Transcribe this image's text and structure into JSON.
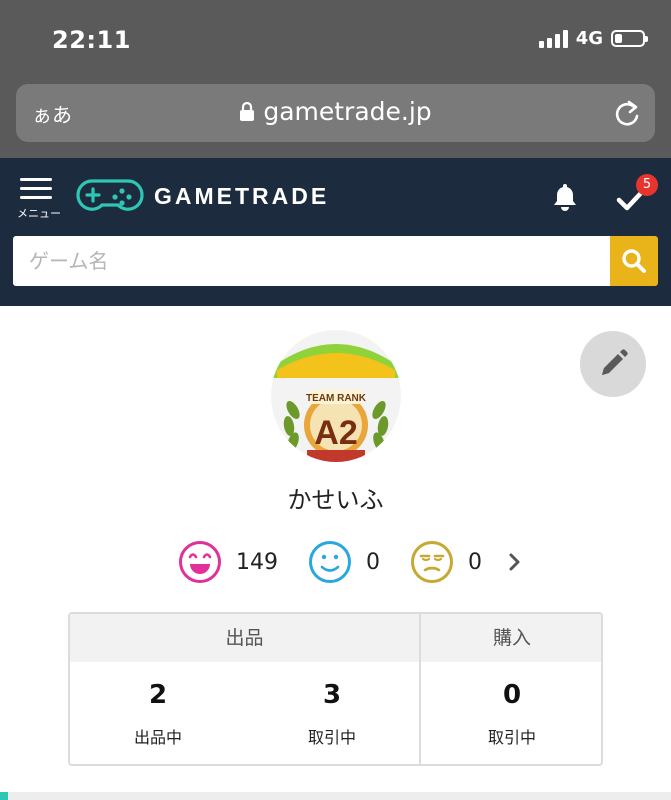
{
  "status_bar": {
    "time": "22:11",
    "network": "4G"
  },
  "browser": {
    "text_size_button": "ぁあ",
    "url": "gametrade.jp"
  },
  "header": {
    "menu_label": "メニュー",
    "logo_text": "GAMETRADE",
    "notification_badge": "5",
    "search_placeholder": "ゲーム名"
  },
  "profile": {
    "avatar_caption": "TEAM RANK A2",
    "username": "かせいふ",
    "ratings": [
      {
        "type": "good",
        "icon": "grin-face-icon",
        "color": "#e0319a",
        "count": "149"
      },
      {
        "type": "normal",
        "icon": "smile-face-icon",
        "color": "#2aa6e0",
        "count": "0"
      },
      {
        "type": "bad",
        "icon": "unamused-face-icon",
        "color": "#c7a832",
        "count": "0"
      }
    ]
  },
  "stats": {
    "selling_header": "出品",
    "buying_header": "購入",
    "items": [
      {
        "value": "2",
        "label": "出品中"
      },
      {
        "value": "3",
        "label": "取引中"
      },
      {
        "value": "0",
        "label": "取引中"
      }
    ]
  },
  "colors": {
    "header_bg": "#1d2b3e",
    "search_button": "#e9b31a",
    "badge": "#e8342f",
    "logo_accent": "#2ec7b5"
  }
}
